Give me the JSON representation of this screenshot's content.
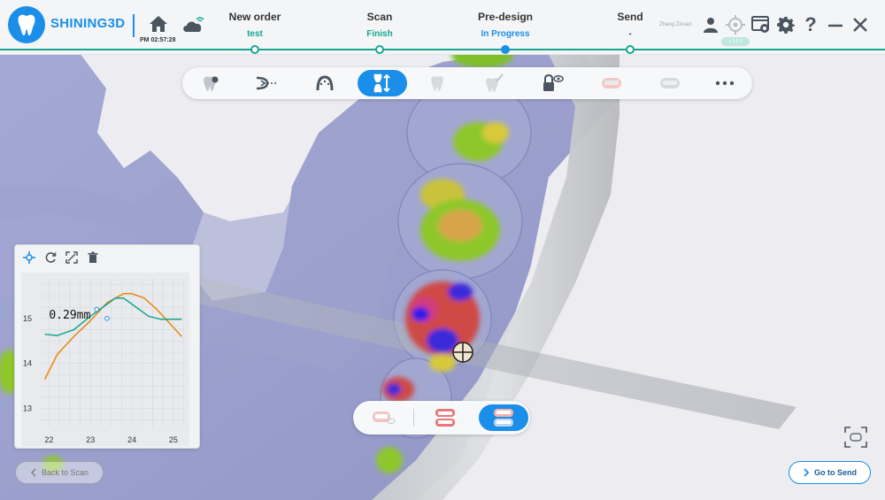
{
  "header": {
    "brand": "SHINING3D",
    "clock": "PM 02:57:28",
    "username": "Zhang Zixuan",
    "version_badge": "v 1.0.0",
    "steps": [
      {
        "title": "New order",
        "status": "test",
        "status_color": "#18a58f"
      },
      {
        "title": "Scan",
        "status": "Finish",
        "status_color": "#18a58f"
      },
      {
        "title": "Pre-design",
        "status": "In Progress",
        "status_color": "#1a8ee8"
      },
      {
        "title": "Send",
        "status": "-",
        "status_color": "#444444"
      }
    ],
    "icons": [
      "home-icon",
      "cloud-wifi-icon",
      "user-icon",
      "target-icon",
      "window-share-icon",
      "gear-icon",
      "help-icon",
      "minimize-icon",
      "close-icon"
    ]
  },
  "toolbar": {
    "tools": [
      "tooth-marker-icon",
      "trim-cut-icon",
      "arch-icon",
      "occlusion-clearance-icon",
      "tooth-disabled-icon",
      "tooth-brush-disabled-icon",
      "lock-eye-icon",
      "upper-jaw-disabled-icon",
      "lower-jaw-disabled-icon",
      "more-icon"
    ],
    "active_index": 3
  },
  "graph_panel": {
    "tools": [
      "move-icon",
      "refresh-icon",
      "expand-icon",
      "trash-icon"
    ],
    "measurement": "0.29mm"
  },
  "chart_data": {
    "type": "line",
    "title": "",
    "xlabel": "",
    "ylabel": "",
    "x_ticks": [
      22,
      23,
      24,
      25
    ],
    "y_ticks": [
      13,
      14,
      15
    ],
    "xlim": [
      21.8,
      25.3
    ],
    "ylim": [
      12.6,
      15.9
    ],
    "series": [
      {
        "color": "#e8880e",
        "x": [
          21.9,
          22.2,
          22.6,
          23.0,
          23.4,
          23.8,
          24.0,
          24.3,
          24.6,
          24.9,
          25.2
        ],
        "y": [
          13.65,
          14.2,
          14.6,
          14.95,
          15.35,
          15.55,
          15.55,
          15.45,
          15.2,
          14.9,
          14.6
        ]
      },
      {
        "color": "#18a58f",
        "x": [
          21.9,
          22.2,
          22.6,
          23.0,
          23.3,
          23.6,
          23.8,
          24.1,
          24.4,
          24.7,
          25.2
        ],
        "y": [
          14.65,
          14.62,
          14.75,
          15.05,
          15.25,
          15.45,
          15.45,
          15.25,
          15.05,
          14.98,
          14.98
        ]
      }
    ],
    "marker_points": [
      {
        "x": 23.15,
        "y": 15.2
      },
      {
        "x": 23.4,
        "y": 15.0
      }
    ]
  },
  "view_switch": {
    "buttons": [
      "upper-jaw-view-icon",
      "both-jaws-view-icon",
      "lower-jaw-view-icon"
    ],
    "active_index": 2
  },
  "buttons": {
    "back": "Back to Scan",
    "send": "Go to Send"
  },
  "colors": {
    "accent": "#1a8ee8",
    "teal": "#18a58f",
    "model": "#9da3cf"
  }
}
